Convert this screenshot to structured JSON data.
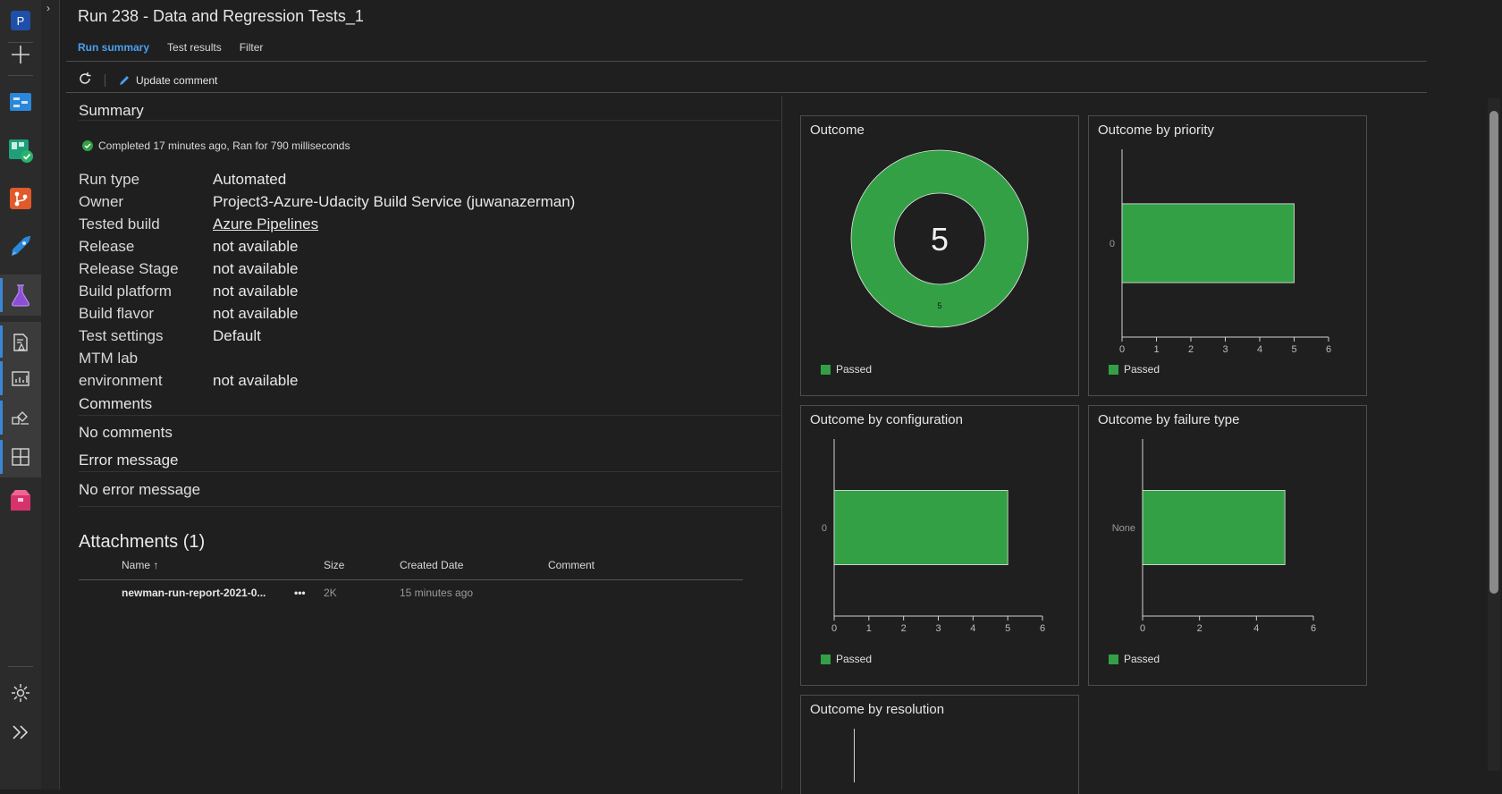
{
  "rail": {
    "items": [
      {
        "name": "project-avatar",
        "label": "P"
      },
      {
        "name": "new-icon"
      },
      {
        "name": "overview-icon"
      },
      {
        "name": "boards-icon"
      },
      {
        "name": "repos-icon"
      },
      {
        "name": "pipelines-icon"
      },
      {
        "name": "test-plans-icon"
      },
      {
        "name": "test-runs-icon"
      },
      {
        "name": "analytics-icon"
      },
      {
        "name": "deployment-icon"
      },
      {
        "name": "dashboard-grid-icon"
      },
      {
        "name": "artifacts-icon"
      }
    ]
  },
  "header": {
    "title": "Run 238 - Data and Regression Tests_1",
    "tabs": [
      {
        "label": "Run summary",
        "active": true
      },
      {
        "label": "Test results",
        "active": false
      },
      {
        "label": "Filter",
        "active": false
      }
    ]
  },
  "toolbar": {
    "update_label": "Update comment"
  },
  "summary": {
    "heading": "Summary",
    "status": "Completed 17 minutes ago, Ran for 790 milliseconds",
    "fields": [
      {
        "key": "Run type",
        "value": "Automated"
      },
      {
        "key": "Owner",
        "value": "Project3-Azure-Udacity Build Service (juwanazerman)"
      },
      {
        "key": "Tested build",
        "value": "Azure Pipelines"
      },
      {
        "key": "Release",
        "value": "not available"
      },
      {
        "key": "Release Stage",
        "value": "not available"
      },
      {
        "key": "Build platform",
        "value": "not available"
      },
      {
        "key": "Build flavor",
        "value": "not available"
      },
      {
        "key": "Test settings",
        "value": "Default"
      },
      {
        "key": "MTM lab",
        "value": ""
      },
      {
        "key": "environment",
        "value": "not available"
      }
    ]
  },
  "comments": {
    "heading": "Comments",
    "text": "No comments"
  },
  "error": {
    "heading": "Error message",
    "text": "No error message"
  },
  "attachments": {
    "heading": "Attachments (1)",
    "columns": {
      "name": "Name ↑",
      "size": "Size",
      "created": "Created Date",
      "comment": "Comment"
    },
    "rows": [
      {
        "name": "newman-run-report-2021-0...",
        "more": "•••",
        "size": "2K",
        "created": "15 minutes ago",
        "comment": ""
      }
    ]
  },
  "colors": {
    "passed": "#33a046",
    "accent": "#4aa0ee"
  },
  "chart_data": [
    {
      "type": "pie",
      "title": "Outcome",
      "center_label": "5",
      "slices": [
        {
          "name": "Passed",
          "value": 5
        }
      ],
      "slice_label": "5",
      "legend": [
        "Passed"
      ]
    },
    {
      "type": "bar",
      "orientation": "horizontal",
      "title": "Outcome by priority",
      "categories": [
        "0"
      ],
      "series": [
        {
          "name": "Passed",
          "values": [
            5
          ]
        }
      ],
      "xlim": [
        0,
        6
      ],
      "xticks": [
        "0",
        "1",
        "2",
        "3",
        "4",
        "5",
        "6"
      ],
      "legend": [
        "Passed"
      ]
    },
    {
      "type": "bar",
      "orientation": "horizontal",
      "title": "Outcome by configuration",
      "categories": [
        "0"
      ],
      "series": [
        {
          "name": "Passed",
          "values": [
            5
          ]
        }
      ],
      "xlim": [
        0,
        6
      ],
      "xticks": [
        "0",
        "1",
        "2",
        "3",
        "4",
        "5",
        "6"
      ],
      "legend": [
        "Passed"
      ]
    },
    {
      "type": "bar",
      "orientation": "horizontal",
      "title": "Outcome by failure type",
      "categories": [
        "None"
      ],
      "series": [
        {
          "name": "Passed",
          "values": [
            5
          ]
        }
      ],
      "xlim": [
        0,
        6
      ],
      "xticks": [
        "0",
        "2",
        "4",
        "6"
      ],
      "legend": [
        "Passed"
      ]
    },
    {
      "type": "bar",
      "orientation": "horizontal",
      "title": "Outcome by resolution",
      "categories": [],
      "series": [],
      "xlim": [
        0,
        6
      ],
      "xticks": [],
      "legend": []
    }
  ]
}
